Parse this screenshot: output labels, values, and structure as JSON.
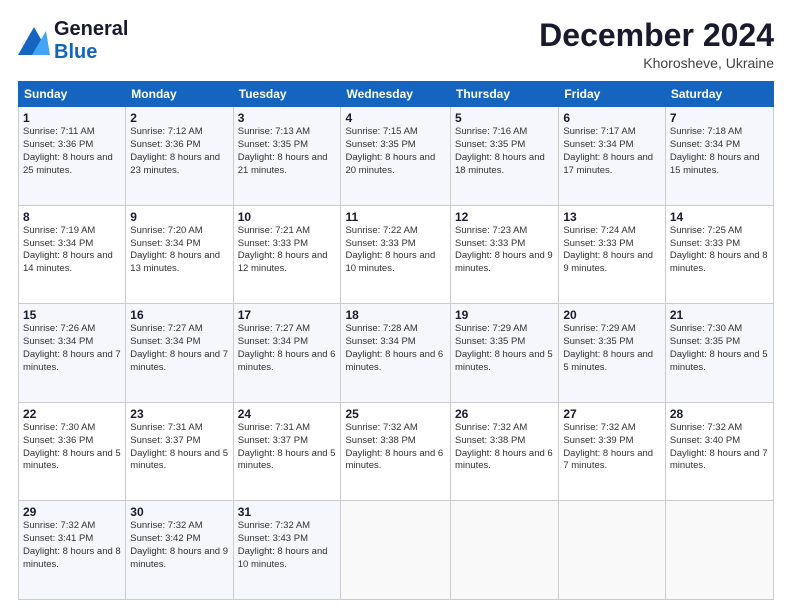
{
  "header": {
    "logo_line1": "General",
    "logo_line2": "Blue",
    "month_title": "December 2024",
    "subtitle": "Khorosheve, Ukraine"
  },
  "days_of_week": [
    "Sunday",
    "Monday",
    "Tuesday",
    "Wednesday",
    "Thursday",
    "Friday",
    "Saturday"
  ],
  "weeks": [
    [
      {
        "day": "1",
        "sunrise": "Sunrise: 7:11 AM",
        "sunset": "Sunset: 3:36 PM",
        "daylight": "Daylight: 8 hours and 25 minutes."
      },
      {
        "day": "2",
        "sunrise": "Sunrise: 7:12 AM",
        "sunset": "Sunset: 3:36 PM",
        "daylight": "Daylight: 8 hours and 23 minutes."
      },
      {
        "day": "3",
        "sunrise": "Sunrise: 7:13 AM",
        "sunset": "Sunset: 3:35 PM",
        "daylight": "Daylight: 8 hours and 21 minutes."
      },
      {
        "day": "4",
        "sunrise": "Sunrise: 7:15 AM",
        "sunset": "Sunset: 3:35 PM",
        "daylight": "Daylight: 8 hours and 20 minutes."
      },
      {
        "day": "5",
        "sunrise": "Sunrise: 7:16 AM",
        "sunset": "Sunset: 3:35 PM",
        "daylight": "Daylight: 8 hours and 18 minutes."
      },
      {
        "day": "6",
        "sunrise": "Sunrise: 7:17 AM",
        "sunset": "Sunset: 3:34 PM",
        "daylight": "Daylight: 8 hours and 17 minutes."
      },
      {
        "day": "7",
        "sunrise": "Sunrise: 7:18 AM",
        "sunset": "Sunset: 3:34 PM",
        "daylight": "Daylight: 8 hours and 15 minutes."
      }
    ],
    [
      {
        "day": "8",
        "sunrise": "Sunrise: 7:19 AM",
        "sunset": "Sunset: 3:34 PM",
        "daylight": "Daylight: 8 hours and 14 minutes."
      },
      {
        "day": "9",
        "sunrise": "Sunrise: 7:20 AM",
        "sunset": "Sunset: 3:34 PM",
        "daylight": "Daylight: 8 hours and 13 minutes."
      },
      {
        "day": "10",
        "sunrise": "Sunrise: 7:21 AM",
        "sunset": "Sunset: 3:33 PM",
        "daylight": "Daylight: 8 hours and 12 minutes."
      },
      {
        "day": "11",
        "sunrise": "Sunrise: 7:22 AM",
        "sunset": "Sunset: 3:33 PM",
        "daylight": "Daylight: 8 hours and 10 minutes."
      },
      {
        "day": "12",
        "sunrise": "Sunrise: 7:23 AM",
        "sunset": "Sunset: 3:33 PM",
        "daylight": "Daylight: 8 hours and 9 minutes."
      },
      {
        "day": "13",
        "sunrise": "Sunrise: 7:24 AM",
        "sunset": "Sunset: 3:33 PM",
        "daylight": "Daylight: 8 hours and 9 minutes."
      },
      {
        "day": "14",
        "sunrise": "Sunrise: 7:25 AM",
        "sunset": "Sunset: 3:33 PM",
        "daylight": "Daylight: 8 hours and 8 minutes."
      }
    ],
    [
      {
        "day": "15",
        "sunrise": "Sunrise: 7:26 AM",
        "sunset": "Sunset: 3:34 PM",
        "daylight": "Daylight: 8 hours and 7 minutes."
      },
      {
        "day": "16",
        "sunrise": "Sunrise: 7:27 AM",
        "sunset": "Sunset: 3:34 PM",
        "daylight": "Daylight: 8 hours and 7 minutes."
      },
      {
        "day": "17",
        "sunrise": "Sunrise: 7:27 AM",
        "sunset": "Sunset: 3:34 PM",
        "daylight": "Daylight: 8 hours and 6 minutes."
      },
      {
        "day": "18",
        "sunrise": "Sunrise: 7:28 AM",
        "sunset": "Sunset: 3:34 PM",
        "daylight": "Daylight: 8 hours and 6 minutes."
      },
      {
        "day": "19",
        "sunrise": "Sunrise: 7:29 AM",
        "sunset": "Sunset: 3:35 PM",
        "daylight": "Daylight: 8 hours and 5 minutes."
      },
      {
        "day": "20",
        "sunrise": "Sunrise: 7:29 AM",
        "sunset": "Sunset: 3:35 PM",
        "daylight": "Daylight: 8 hours and 5 minutes."
      },
      {
        "day": "21",
        "sunrise": "Sunrise: 7:30 AM",
        "sunset": "Sunset: 3:35 PM",
        "daylight": "Daylight: 8 hours and 5 minutes."
      }
    ],
    [
      {
        "day": "22",
        "sunrise": "Sunrise: 7:30 AM",
        "sunset": "Sunset: 3:36 PM",
        "daylight": "Daylight: 8 hours and 5 minutes."
      },
      {
        "day": "23",
        "sunrise": "Sunrise: 7:31 AM",
        "sunset": "Sunset: 3:37 PM",
        "daylight": "Daylight: 8 hours and 5 minutes."
      },
      {
        "day": "24",
        "sunrise": "Sunrise: 7:31 AM",
        "sunset": "Sunset: 3:37 PM",
        "daylight": "Daylight: 8 hours and 5 minutes."
      },
      {
        "day": "25",
        "sunrise": "Sunrise: 7:32 AM",
        "sunset": "Sunset: 3:38 PM",
        "daylight": "Daylight: 8 hours and 6 minutes."
      },
      {
        "day": "26",
        "sunrise": "Sunrise: 7:32 AM",
        "sunset": "Sunset: 3:38 PM",
        "daylight": "Daylight: 8 hours and 6 minutes."
      },
      {
        "day": "27",
        "sunrise": "Sunrise: 7:32 AM",
        "sunset": "Sunset: 3:39 PM",
        "daylight": "Daylight: 8 hours and 7 minutes."
      },
      {
        "day": "28",
        "sunrise": "Sunrise: 7:32 AM",
        "sunset": "Sunset: 3:40 PM",
        "daylight": "Daylight: 8 hours and 7 minutes."
      }
    ],
    [
      {
        "day": "29",
        "sunrise": "Sunrise: 7:32 AM",
        "sunset": "Sunset: 3:41 PM",
        "daylight": "Daylight: 8 hours and 8 minutes."
      },
      {
        "day": "30",
        "sunrise": "Sunrise: 7:32 AM",
        "sunset": "Sunset: 3:42 PM",
        "daylight": "Daylight: 8 hours and 9 minutes."
      },
      {
        "day": "31",
        "sunrise": "Sunrise: 7:32 AM",
        "sunset": "Sunset: 3:43 PM",
        "daylight": "Daylight: 8 hours and 10 minutes."
      },
      null,
      null,
      null,
      null
    ]
  ]
}
